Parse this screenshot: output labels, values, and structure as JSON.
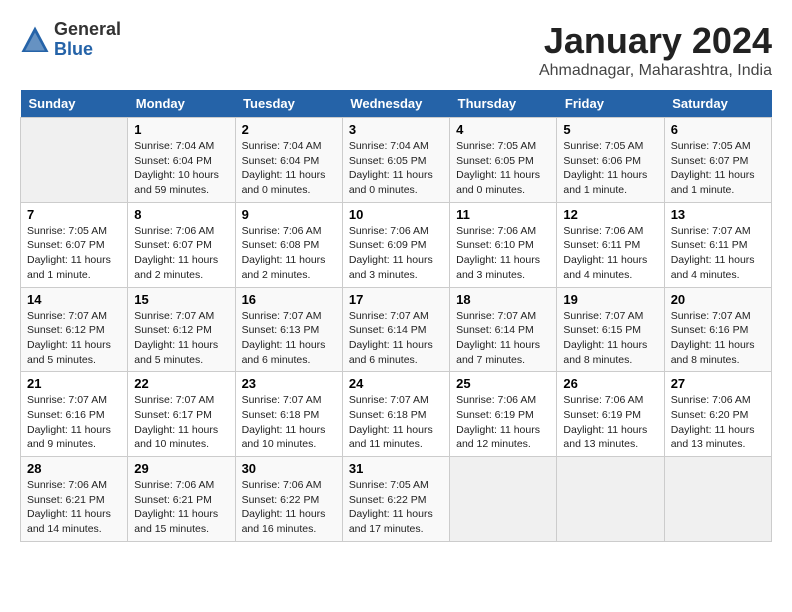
{
  "header": {
    "logo_general": "General",
    "logo_blue": "Blue",
    "month_year": "January 2024",
    "location": "Ahmadnagar, Maharashtra, India"
  },
  "days_of_week": [
    "Sunday",
    "Monday",
    "Tuesday",
    "Wednesday",
    "Thursday",
    "Friday",
    "Saturday"
  ],
  "weeks": [
    [
      {
        "day": "",
        "info": ""
      },
      {
        "day": "1",
        "info": "Sunrise: 7:04 AM\nSunset: 6:04 PM\nDaylight: 10 hours\nand 59 minutes."
      },
      {
        "day": "2",
        "info": "Sunrise: 7:04 AM\nSunset: 6:04 PM\nDaylight: 11 hours\nand 0 minutes."
      },
      {
        "day": "3",
        "info": "Sunrise: 7:04 AM\nSunset: 6:05 PM\nDaylight: 11 hours\nand 0 minutes."
      },
      {
        "day": "4",
        "info": "Sunrise: 7:05 AM\nSunset: 6:05 PM\nDaylight: 11 hours\nand 0 minutes."
      },
      {
        "day": "5",
        "info": "Sunrise: 7:05 AM\nSunset: 6:06 PM\nDaylight: 11 hours\nand 1 minute."
      },
      {
        "day": "6",
        "info": "Sunrise: 7:05 AM\nSunset: 6:07 PM\nDaylight: 11 hours\nand 1 minute."
      }
    ],
    [
      {
        "day": "7",
        "info": "Sunrise: 7:05 AM\nSunset: 6:07 PM\nDaylight: 11 hours\nand 1 minute."
      },
      {
        "day": "8",
        "info": "Sunrise: 7:06 AM\nSunset: 6:07 PM\nDaylight: 11 hours\nand 2 minutes."
      },
      {
        "day": "9",
        "info": "Sunrise: 7:06 AM\nSunset: 6:08 PM\nDaylight: 11 hours\nand 2 minutes."
      },
      {
        "day": "10",
        "info": "Sunrise: 7:06 AM\nSunset: 6:09 PM\nDaylight: 11 hours\nand 3 minutes."
      },
      {
        "day": "11",
        "info": "Sunrise: 7:06 AM\nSunset: 6:10 PM\nDaylight: 11 hours\nand 3 minutes."
      },
      {
        "day": "12",
        "info": "Sunrise: 7:06 AM\nSunset: 6:11 PM\nDaylight: 11 hours\nand 4 minutes."
      },
      {
        "day": "13",
        "info": "Sunrise: 7:07 AM\nSunset: 6:11 PM\nDaylight: 11 hours\nand 4 minutes."
      }
    ],
    [
      {
        "day": "14",
        "info": "Sunrise: 7:07 AM\nSunset: 6:12 PM\nDaylight: 11 hours\nand 5 minutes."
      },
      {
        "day": "15",
        "info": "Sunrise: 7:07 AM\nSunset: 6:12 PM\nDaylight: 11 hours\nand 5 minutes."
      },
      {
        "day": "16",
        "info": "Sunrise: 7:07 AM\nSunset: 6:13 PM\nDaylight: 11 hours\nand 6 minutes."
      },
      {
        "day": "17",
        "info": "Sunrise: 7:07 AM\nSunset: 6:14 PM\nDaylight: 11 hours\nand 6 minutes."
      },
      {
        "day": "18",
        "info": "Sunrise: 7:07 AM\nSunset: 6:14 PM\nDaylight: 11 hours\nand 7 minutes."
      },
      {
        "day": "19",
        "info": "Sunrise: 7:07 AM\nSunset: 6:15 PM\nDaylight: 11 hours\nand 8 minutes."
      },
      {
        "day": "20",
        "info": "Sunrise: 7:07 AM\nSunset: 6:16 PM\nDaylight: 11 hours\nand 8 minutes."
      }
    ],
    [
      {
        "day": "21",
        "info": "Sunrise: 7:07 AM\nSunset: 6:16 PM\nDaylight: 11 hours\nand 9 minutes."
      },
      {
        "day": "22",
        "info": "Sunrise: 7:07 AM\nSunset: 6:17 PM\nDaylight: 11 hours\nand 10 minutes."
      },
      {
        "day": "23",
        "info": "Sunrise: 7:07 AM\nSunset: 6:18 PM\nDaylight: 11 hours\nand 10 minutes."
      },
      {
        "day": "24",
        "info": "Sunrise: 7:07 AM\nSunset: 6:18 PM\nDaylight: 11 hours\nand 11 minutes."
      },
      {
        "day": "25",
        "info": "Sunrise: 7:06 AM\nSunset: 6:19 PM\nDaylight: 11 hours\nand 12 minutes."
      },
      {
        "day": "26",
        "info": "Sunrise: 7:06 AM\nSunset: 6:19 PM\nDaylight: 11 hours\nand 13 minutes."
      },
      {
        "day": "27",
        "info": "Sunrise: 7:06 AM\nSunset: 6:20 PM\nDaylight: 11 hours\nand 13 minutes."
      }
    ],
    [
      {
        "day": "28",
        "info": "Sunrise: 7:06 AM\nSunset: 6:21 PM\nDaylight: 11 hours\nand 14 minutes."
      },
      {
        "day": "29",
        "info": "Sunrise: 7:06 AM\nSunset: 6:21 PM\nDaylight: 11 hours\nand 15 minutes."
      },
      {
        "day": "30",
        "info": "Sunrise: 7:06 AM\nSunset: 6:22 PM\nDaylight: 11 hours\nand 16 minutes."
      },
      {
        "day": "31",
        "info": "Sunrise: 7:05 AM\nSunset: 6:22 PM\nDaylight: 11 hours\nand 17 minutes."
      },
      {
        "day": "",
        "info": ""
      },
      {
        "day": "",
        "info": ""
      },
      {
        "day": "",
        "info": ""
      }
    ]
  ]
}
